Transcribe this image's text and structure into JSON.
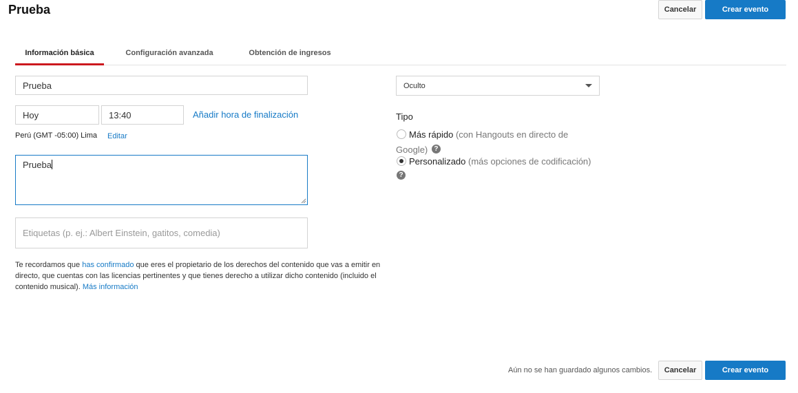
{
  "header": {
    "title": "Prueba",
    "cancel_label": "Cancelar",
    "create_label": "Crear evento"
  },
  "tabs": [
    {
      "label": "Información básica",
      "active": true
    },
    {
      "label": "Configuración avanzada",
      "active": false
    },
    {
      "label": "Obtención de ingresos",
      "active": false
    }
  ],
  "form": {
    "title_value": "Prueba",
    "date_value": "Hoy",
    "time_value": "13:40",
    "add_end_time_link": "Añadir hora de finalización",
    "timezone_text": "Perú (GMT -05:00) Lima",
    "edit_link": "Editar",
    "description_value": "Prueba",
    "tags_placeholder": "Etiquetas (p. ej.: Albert Einstein, gatitos, comedia)"
  },
  "note": {
    "prefix": "Te recordamos que",
    "link1": "has confirmado",
    "middle": "que eres el propietario de los derechos del contenido que vas a emitir en directo, que cuentas con las licencias pertinentes y que tienes derecho a utilizar dicho contenido (incluido el contenido musical).",
    "link2": "Más información"
  },
  "privacy": {
    "selected": "Oculto"
  },
  "type": {
    "heading": "Tipo",
    "option1_label": "Más rápido",
    "option1_detail_a": "(con Hangouts en directo de",
    "option1_detail_b": "Google)",
    "option2_label": "Personalizado",
    "option2_detail": "(más opciones de codificación)",
    "selected": "Personalizado"
  },
  "footer": {
    "unsaved_text": "Aún no se han guardado algunos cambios.",
    "cancel_label": "Cancelar",
    "create_label": "Crear evento"
  },
  "icons": {
    "help": "question-mark-circle-icon",
    "dropdown": "caret-down-icon"
  },
  "colors": {
    "primary": "#167ac6",
    "active_tab": "#cc181e"
  }
}
